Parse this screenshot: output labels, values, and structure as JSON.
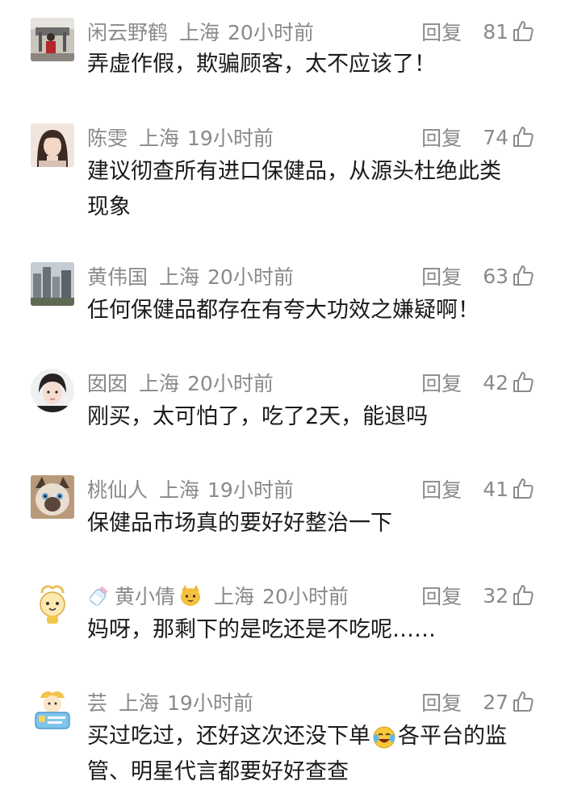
{
  "comments": [
    {
      "name": "闲云野鹤",
      "location": "上海",
      "time": "20小时前",
      "reply_label": "回复",
      "likes": "81",
      "text": "弄虚作假，欺骗顾客，太不应该了！"
    },
    {
      "name": "陈雯",
      "location": "上海",
      "time": "19小时前",
      "reply_label": "回复",
      "likes": "74",
      "text_line1": "建议彻查所有进口保健品，从源头杜绝此类",
      "text_line2": "现象"
    },
    {
      "name": "黄伟国",
      "location": "上海",
      "time": "20小时前",
      "reply_label": "回复",
      "likes": "63",
      "text": "任何保健品都存在有夸大功效之嫌疑啊！"
    },
    {
      "name": "囡囡",
      "location": "上海",
      "time": "20小时前",
      "reply_label": "回复",
      "likes": "42",
      "text": "刚买，太可怕了，吃了2天，能退吗"
    },
    {
      "name": "桃仙人",
      "location": "上海",
      "time": "19小时前",
      "reply_label": "回复",
      "likes": "41",
      "text": "保健品市场真的要好好整治一下"
    },
    {
      "name": "黄小倩",
      "location": "上海",
      "time": "20小时前",
      "reply_label": "回复",
      "likes": "32",
      "text": "妈呀，那剩下的是吃还是不吃呢……"
    },
    {
      "name": "芸",
      "location": "上海",
      "time": "19小时前",
      "reply_label": "回复",
      "likes": "27",
      "text_part1": "买过吃过，还好这次还没下单",
      "text_part2": "各平台的监",
      "text_line2": "管、明星代言都要好好查查"
    }
  ]
}
